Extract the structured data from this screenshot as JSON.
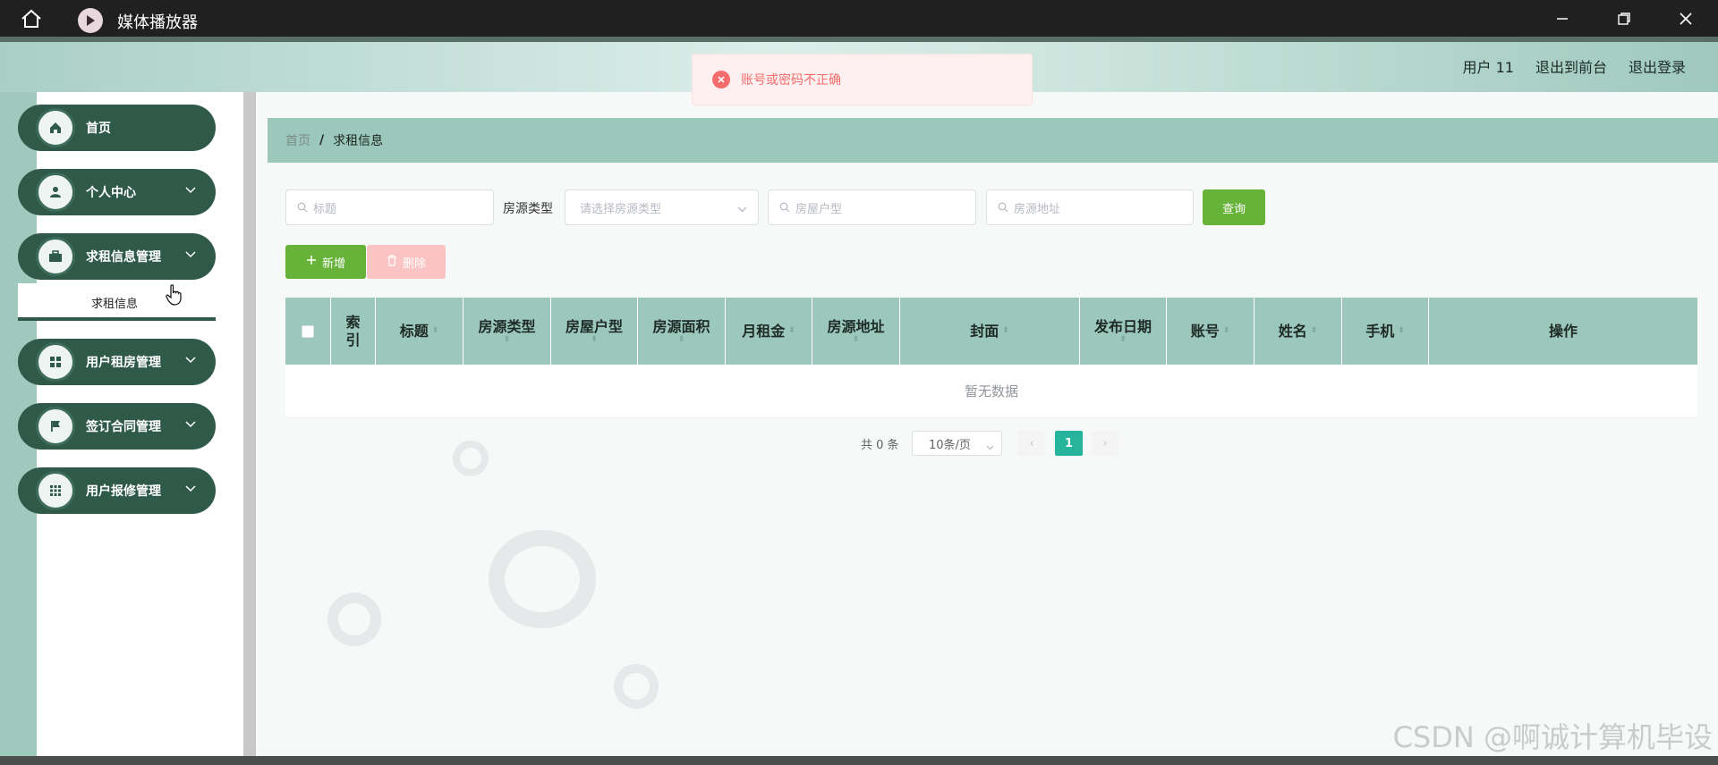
{
  "window": {
    "title": "媒体播放器"
  },
  "header": {
    "user": "用户 11",
    "to_front": "退出到前台",
    "logout": "退出登录"
  },
  "toast": {
    "message": "账号或密码不正确"
  },
  "sidebar": {
    "items": [
      {
        "label": "首页",
        "icon": "home-icon"
      },
      {
        "label": "个人中心",
        "icon": "user-icon"
      },
      {
        "label": "求租信息管理",
        "icon": "briefcase-icon"
      },
      {
        "label": "用户租房管理",
        "icon": "grid-icon"
      },
      {
        "label": "签订合同管理",
        "icon": "flag-icon"
      },
      {
        "label": "用户报修管理",
        "icon": "apps-icon"
      }
    ],
    "submenu": {
      "label": "求租信息"
    }
  },
  "breadcrumb": {
    "home": "首页",
    "separator": "/",
    "current": "求租信息"
  },
  "filters": {
    "title_placeholder": "标题",
    "type_label": "房源类型",
    "type_placeholder": "请选择房源类型",
    "layout_placeholder": "房屋户型",
    "address_placeholder": "房源地址",
    "query": "查询"
  },
  "actions": {
    "add": "新增",
    "delete": "删除"
  },
  "table": {
    "columns": [
      "索引",
      "标题",
      "房源类型",
      "房屋户型",
      "房源面积",
      "月租金",
      "房源地址",
      "封面",
      "发布日期",
      "账号",
      "姓名",
      "手机",
      "操作"
    ],
    "empty_text": "暂无数据"
  },
  "pagination": {
    "total": "共 0 条",
    "page_size": "10条/页",
    "prev": "‹",
    "next": "›",
    "current_page": "1"
  },
  "watermark": "CSDN @啊诚计算机毕设",
  "colors": {
    "accent_dark": "#2f5a4a",
    "accent_light": "#9cc7bb",
    "success": "#67b33a",
    "danger": "#f56c6c",
    "page_active": "#26b59c"
  }
}
